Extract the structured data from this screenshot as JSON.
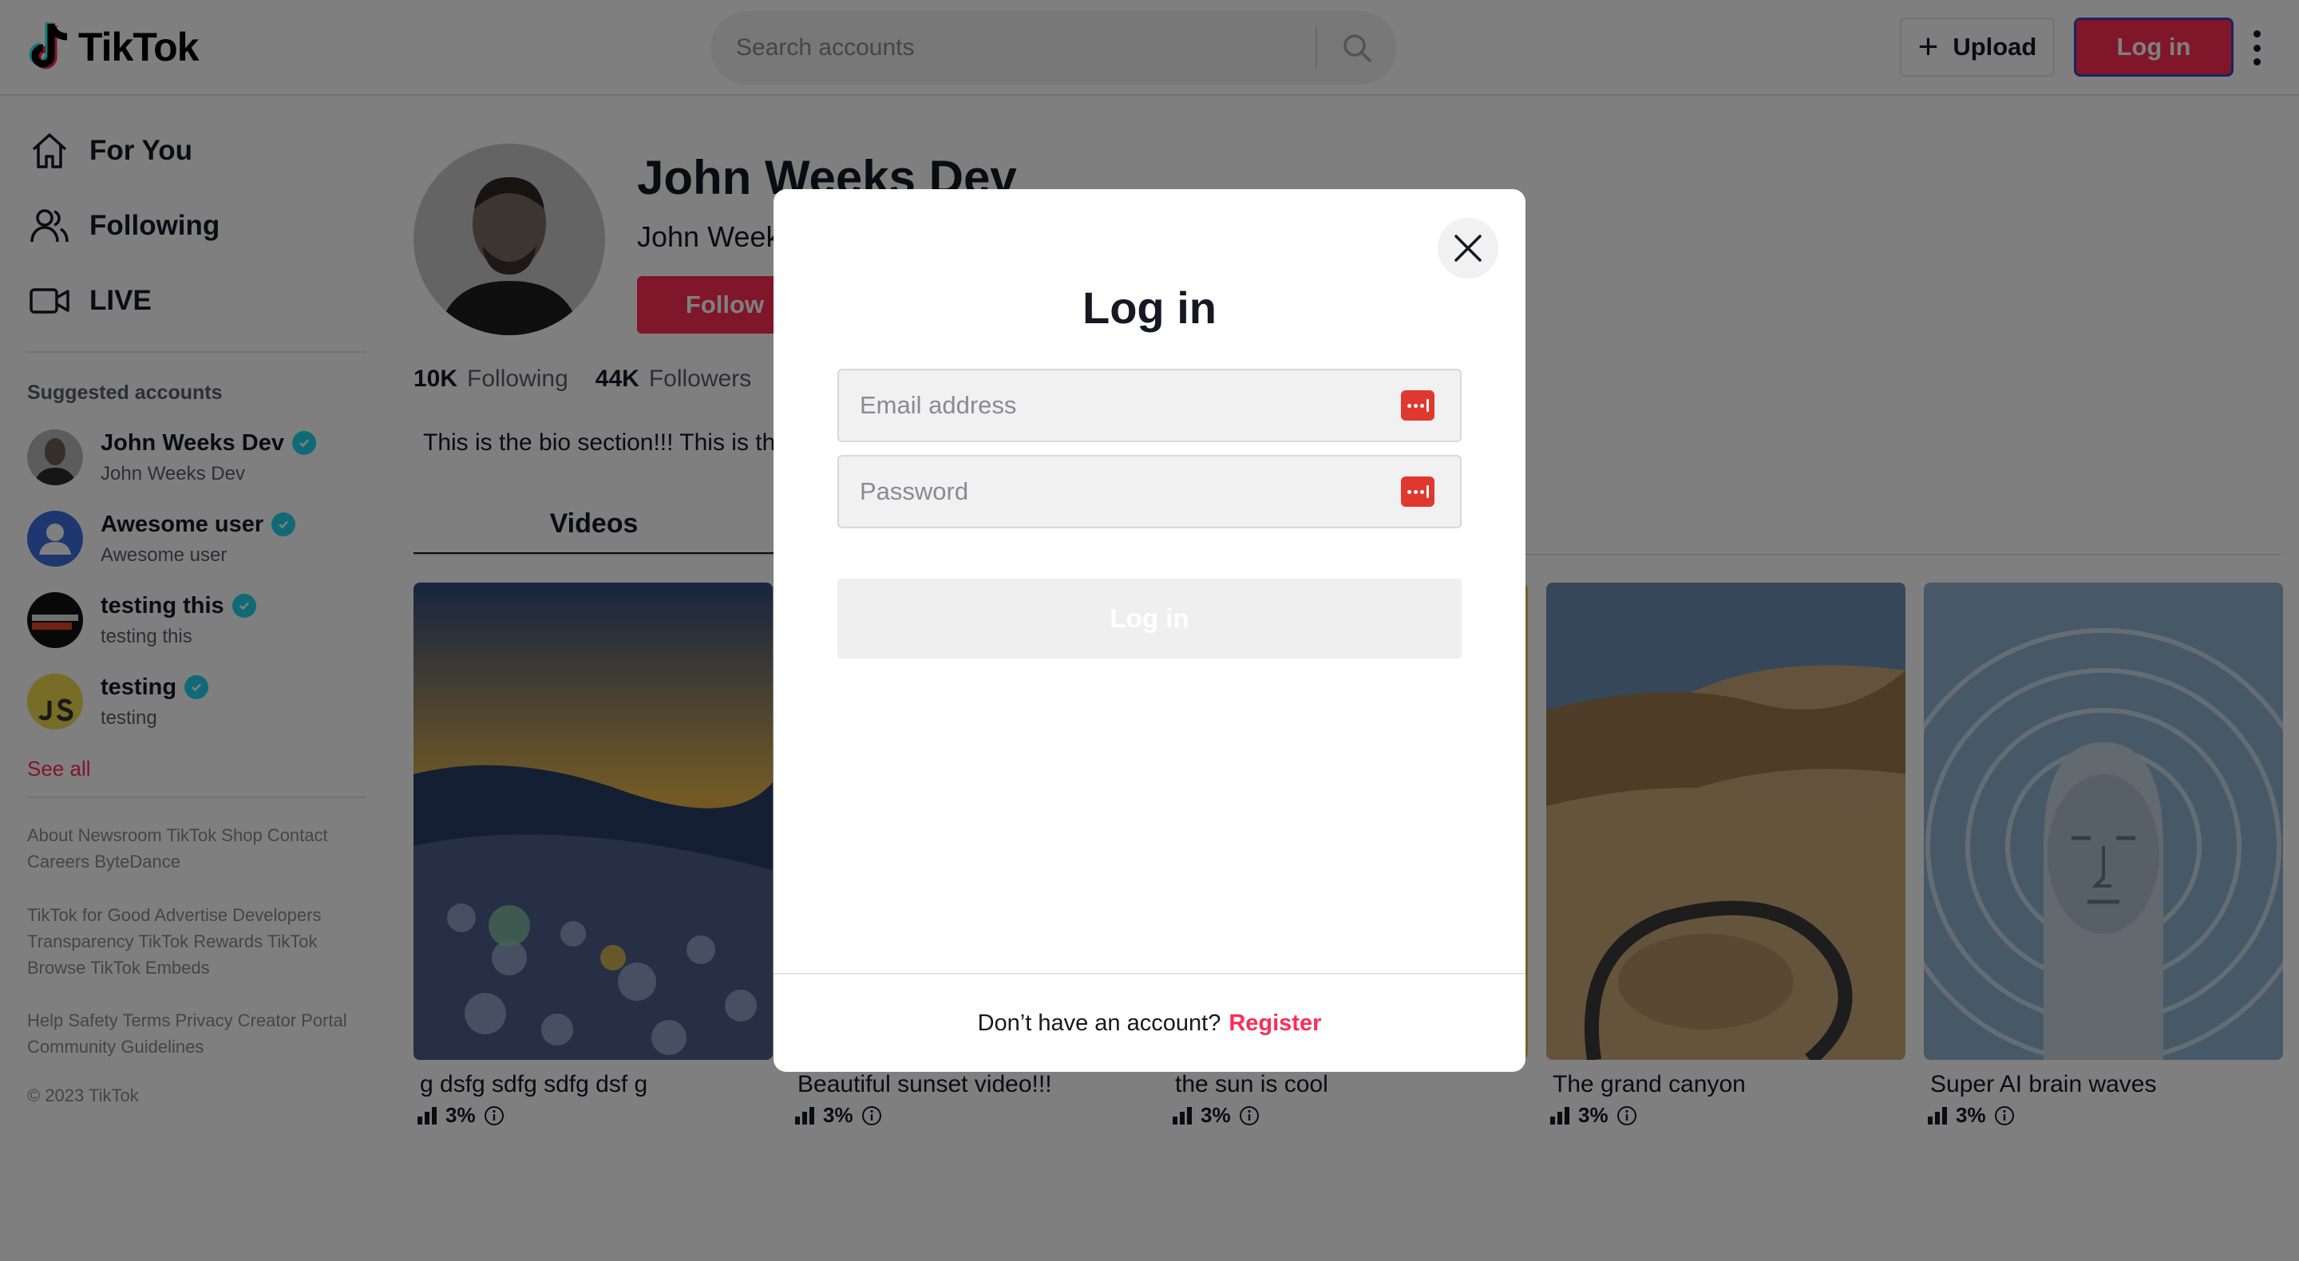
{
  "header": {
    "brand": "TikTok",
    "search_placeholder": "Search accounts",
    "upload_label": "Upload",
    "login_label": "Log in"
  },
  "sidebar": {
    "nav": [
      {
        "label": "For You",
        "icon": "home-icon"
      },
      {
        "label": "Following",
        "icon": "people-icon"
      },
      {
        "label": "LIVE",
        "icon": "video-camera-icon"
      }
    ],
    "suggested_heading": "Suggested accounts",
    "accounts": [
      {
        "name": "John Weeks Dev",
        "sub": "John Weeks Dev",
        "verified": true
      },
      {
        "name": "Awesome user",
        "sub": "Awesome user",
        "verified": true
      },
      {
        "name": "testing this",
        "sub": "testing this",
        "verified": true
      },
      {
        "name": "testing",
        "sub": "testing",
        "verified": true
      }
    ],
    "see_all": "See all",
    "footer_1": "About Newsroom TikTok Shop Contact Careers ByteDance",
    "footer_2": "TikTok for Good Advertise Developers Transparency TikTok Rewards TikTok Browse TikTok Embeds",
    "footer_3": "Help Safety Terms Privacy Creator Portal Community Guidelines",
    "copyright": "© 2023 TikTok"
  },
  "profile": {
    "name": "John Weeks Dev",
    "handle": "John Weeks Dev",
    "follow_label": "Follow",
    "following_count": "10K",
    "following_label": "Following",
    "followers_count": "44K",
    "followers_label": "Followers",
    "bio": "This is the bio section!!! This is the bio section!!!",
    "tab_videos": "Videos"
  },
  "videos": [
    {
      "caption": "g dsfg sdfg sdfg dsf g",
      "stat": "3%"
    },
    {
      "caption": "Beautiful sunset video!!!",
      "stat": "3%"
    },
    {
      "caption": "the sun is cool",
      "stat": "3%"
    },
    {
      "caption": "The grand canyon",
      "stat": "3%"
    },
    {
      "caption": "Super AI brain waves",
      "stat": "3%"
    }
  ],
  "modal": {
    "title": "Log in",
    "email_placeholder": "Email address",
    "password_placeholder": "Password",
    "submit_label": "Log in",
    "footer_question": "Don’t have an account?",
    "register_label": "Register"
  },
  "colors": {
    "accent": "#fe2c55",
    "verified": "#20d5ec",
    "overlay": "rgba(0,0,0,0.5)"
  }
}
